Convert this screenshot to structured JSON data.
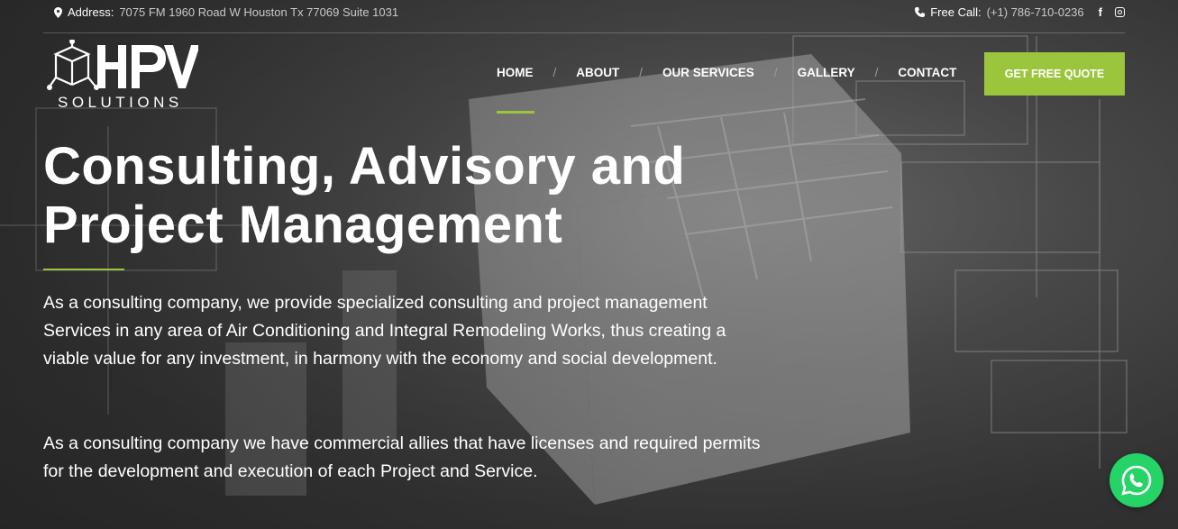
{
  "topbar": {
    "address_label": "Address:",
    "address_value": "7075 FM 1960 Road W Houston Tx 77069 Suite 1031",
    "phone_label": "Free Call:",
    "phone_value": "(+1) 786-710-0236",
    "social_facebook": "f",
    "icons": [
      "map-pin-icon",
      "phone-icon",
      "facebook-icon",
      "instagram-icon"
    ]
  },
  "logo": {
    "letters": "HPV",
    "subtitle": "SOLUTIONS"
  },
  "nav": {
    "items": [
      {
        "label": "HOME",
        "active": true
      },
      {
        "label": "ABOUT"
      },
      {
        "label": "OUR SERVICES"
      },
      {
        "label": "GALLERY"
      },
      {
        "label": "CONTACT"
      }
    ],
    "separator": "/",
    "cta": "GET FREE QUOTE"
  },
  "hero": {
    "title_line1": "Consulting, Advisory and",
    "title_line2": "Project Management",
    "paragraph1": "As a consulting company, we provide specialized consulting and project management Services in any area of Air Conditioning and Integral Remodeling Works, thus creating a viable value for any investment, in harmony with the economy and social development.",
    "paragraph2": "As a consulting company we have commercial allies that have licenses and required permits for the development and execution of each Project and Service."
  },
  "colors": {
    "accent": "#9bc53d",
    "whatsapp": "#25d366",
    "text": "#ffffff"
  },
  "floating": {
    "icon": "whatsapp-icon"
  }
}
